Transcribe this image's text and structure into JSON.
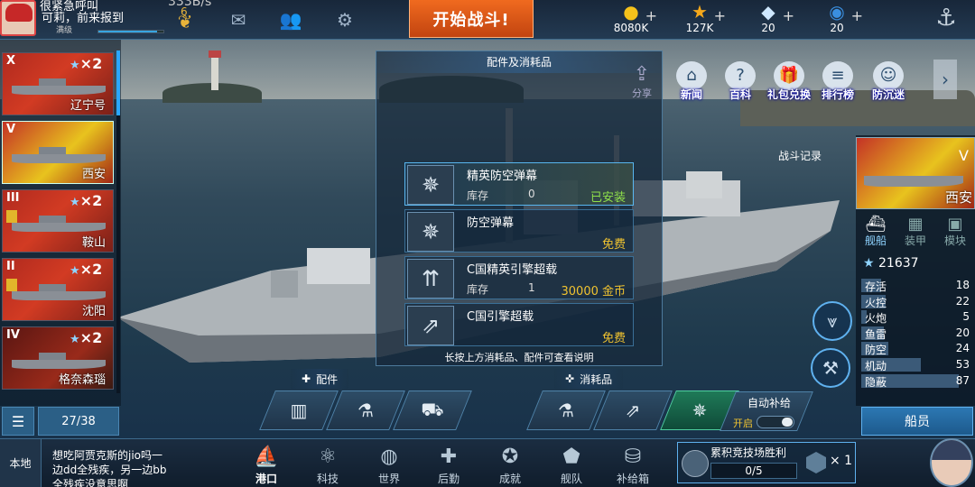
{
  "topbar": {
    "player_name": "很紧急呼叫",
    "status_line": "可莉，前来报到",
    "level_label": "满级",
    "xp_progress": 0.9,
    "top_number": "333B/s",
    "rank_number": "6",
    "battle_button": "开始战斗!",
    "icons": [
      "mail-icon",
      "friends-icon",
      "gear-icon"
    ],
    "resources": [
      {
        "icon": "gold-coin-icon",
        "value": "8080K"
      },
      {
        "icon": "star-icon",
        "value": "127K"
      },
      {
        "icon": "diamond-icon",
        "value": "20"
      },
      {
        "icon": "globe-icon",
        "value": "20"
      }
    ]
  },
  "ship_list": [
    {
      "tier": "X",
      "mult": "×2",
      "name": "辽宁号",
      "style": "normal"
    },
    {
      "tier": "V",
      "mult": "",
      "name": "西安",
      "style": "selected"
    },
    {
      "tier": "III",
      "mult": "×2",
      "name": "鞍山",
      "style": "normal"
    },
    {
      "tier": "II",
      "mult": "×2",
      "name": "沈阳",
      "style": "normal"
    },
    {
      "tier": "IV",
      "mult": "×2",
      "name": "格奈森瑙",
      "style": "dark"
    }
  ],
  "list_count": "27/38",
  "popup": {
    "title": "配件及消耗品",
    "items": [
      {
        "name": "精英防空弹幕",
        "label": "库存",
        "stock": "0",
        "status": "已安装",
        "status_color": "green",
        "active": true,
        "icon": "aa-barrage-icon"
      },
      {
        "name": "防空弹幕",
        "label": "",
        "stock": "",
        "status": "免费",
        "status_color": "gold",
        "active": false,
        "icon": "aa-barrage-icon"
      },
      {
        "name": "C国精英引擎超载",
        "label": "库存",
        "stock": "1",
        "status": "30000 金币",
        "status_color": "gold",
        "active": false,
        "icon": "engine-boost-icon"
      },
      {
        "name": "C国引擎超载",
        "label": "",
        "stock": "",
        "status": "免费",
        "status_color": "gold",
        "active": false,
        "icon": "engine-boost-icon"
      }
    ],
    "hint": "长按上方消耗品、配件可查看说明"
  },
  "slots": {
    "parts_tab": "配件",
    "consumables_tab": "消耗品",
    "auto_supply": "自动补给",
    "auto_on": "开启"
  },
  "menu": [
    {
      "label": "新闻",
      "icon": "news-icon"
    },
    {
      "label": "百科",
      "icon": "wiki-icon"
    },
    {
      "label": "礼包兑换",
      "icon": "gift-icon"
    },
    {
      "label": "排行榜",
      "icon": "ranking-icon"
    },
    {
      "label": "防沉迷",
      "icon": "anti-addiction-icon"
    }
  ],
  "battle_record": "战斗记录",
  "share_label": "分享",
  "right_panel": {
    "tier": "V",
    "ship_name": "西安",
    "tabs": [
      "舰船",
      "装甲",
      "模块"
    ],
    "power": "21637",
    "stats": [
      {
        "label": "存活",
        "value": "18",
        "fill": 0.18
      },
      {
        "label": "火控",
        "value": "22",
        "fill": 0.22
      },
      {
        "label": "火炮",
        "value": "5",
        "fill": 0.05
      },
      {
        "label": "鱼雷",
        "value": "20",
        "fill": 0.2
      },
      {
        "label": "防空",
        "value": "24",
        "fill": 0.24
      },
      {
        "label": "机动",
        "value": "53",
        "fill": 0.53
      },
      {
        "label": "隐蔽",
        "value": "87",
        "fill": 0.87
      }
    ],
    "crew_button": "船员"
  },
  "bottom": {
    "local": "本地",
    "chat": "想吃阿贾克斯的jio吗一边dd全残疾，另一边bb全残疾没意思啊",
    "nav": [
      {
        "label": "港口",
        "icon": "port-icon",
        "on": true
      },
      {
        "label": "科技",
        "icon": "tech-icon",
        "on": false
      },
      {
        "label": "世界",
        "icon": "world-icon",
        "on": false
      },
      {
        "label": "后勤",
        "icon": "logistics-icon",
        "on": false
      },
      {
        "label": "成就",
        "icon": "achievement-icon",
        "on": false
      },
      {
        "label": "舰队",
        "icon": "fleet-icon",
        "on": false
      },
      {
        "label": "补给箱",
        "icon": "supply-box-icon",
        "on": false
      }
    ],
    "arena_title": "累积竞技场胜利",
    "arena_progress": "0/5",
    "arena_reward": "× 1"
  }
}
